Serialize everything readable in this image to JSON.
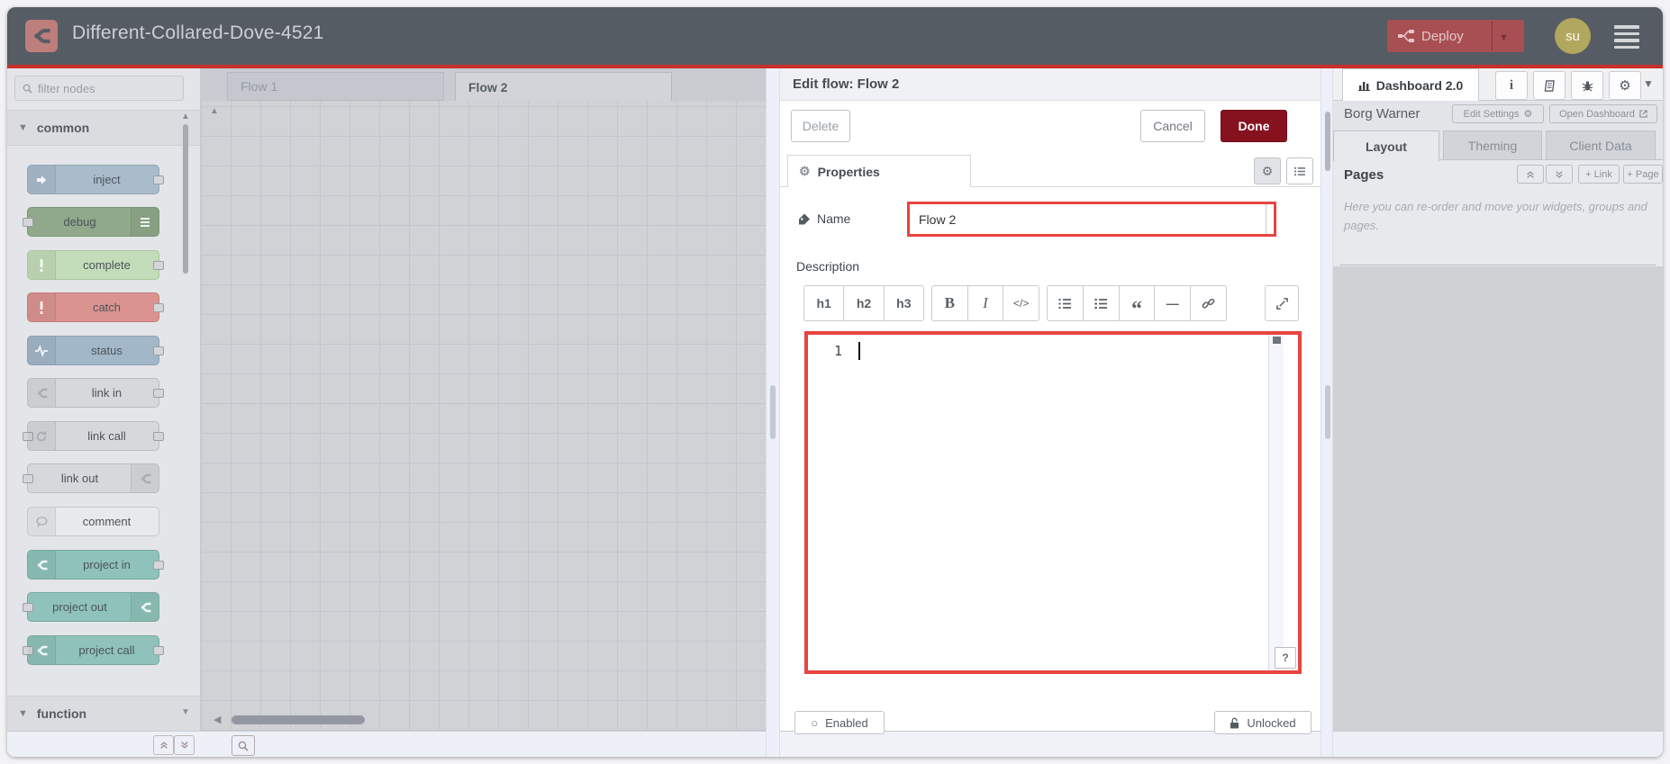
{
  "header": {
    "title": "Different-Collared-Dove-4521",
    "deploy_label": "Deploy",
    "avatar_initials": "su"
  },
  "palette": {
    "search_placeholder": "filter nodes",
    "categories": [
      {
        "label": "common"
      },
      {
        "label": "function"
      }
    ],
    "nodes": [
      {
        "label": "inject",
        "icon": "arrow-right-icon",
        "icon_side": "left",
        "ports": "right",
        "fill": "#a9bccc",
        "border": "#91a7b8",
        "glyph": "#f3f5f7"
      },
      {
        "label": "debug",
        "icon": "list-icon",
        "icon_side": "right",
        "ports": "left",
        "fill": "#8fa98a",
        "border": "#7b9477",
        "glyph": "#eef2ee"
      },
      {
        "label": "complete",
        "icon": "exclamation-icon",
        "icon_side": "left",
        "ports": "right",
        "fill": "#c3dcb9",
        "border": "#a8c79d",
        "glyph": "#f6faf4"
      },
      {
        "label": "catch",
        "icon": "exclamation-icon",
        "icon_side": "left",
        "ports": "right",
        "fill": "#db9390",
        "border": "#c17e7b",
        "glyph": "#f9efee"
      },
      {
        "label": "status",
        "icon": "pulse-icon",
        "icon_side": "left",
        "ports": "right",
        "fill": "#a2b7c7",
        "border": "#8ba3b4",
        "glyph": "#f2f5f8"
      },
      {
        "label": "link in",
        "icon": "fork-icon",
        "icon_side": "left",
        "ports": "right",
        "fill": "#d6d8db",
        "border": "#b9bdc2",
        "glyph": "#a9adb4"
      },
      {
        "label": "link call",
        "icon": "rotate-icon",
        "icon_side": "left",
        "ports": "both",
        "fill": "#d6d8db",
        "border": "#b9bdc2",
        "glyph": "#a9adb4"
      },
      {
        "label": "link out",
        "icon": "fork-icon",
        "icon_side": "right",
        "ports": "left",
        "fill": "#d6d8db",
        "border": "#b9bdc2",
        "glyph": "#a9adb4"
      },
      {
        "label": "comment",
        "icon": "bubble-icon",
        "icon_side": "left",
        "ports": "none",
        "fill": "#e8e9eb",
        "border": "#c5c8cd",
        "glyph": "#a9adb4"
      },
      {
        "label": "project in",
        "icon": "fork-icon",
        "icon_side": "left",
        "ports": "right",
        "fill": "#8fc2ba",
        "border": "#78a9a1",
        "glyph": "#f0f7f6"
      },
      {
        "label": "project out",
        "icon": "fork-icon",
        "icon_side": "right",
        "ports": "left",
        "fill": "#8fc2ba",
        "border": "#78a9a1",
        "glyph": "#f0f7f6"
      },
      {
        "label": "project call",
        "icon": "fork-icon",
        "icon_side": "left",
        "ports": "both",
        "fill": "#8fc2ba",
        "border": "#78a9a1",
        "glyph": "#f0f7f6"
      }
    ]
  },
  "workspace": {
    "tabs": [
      {
        "label": "Flow 1",
        "active": false
      },
      {
        "label": "Flow 2",
        "active": true
      }
    ]
  },
  "dialog": {
    "title": "Edit flow: Flow 2",
    "delete_label": "Delete",
    "cancel_label": "Cancel",
    "done_label": "Done",
    "properties_tab_label": "Properties",
    "name_label": "Name",
    "name_value": "Flow 2",
    "description_label": "Description",
    "toolbar_groups": [
      [
        {
          "id": "h1",
          "label": "h1"
        },
        {
          "id": "h2",
          "label": "h2"
        },
        {
          "id": "h3",
          "label": "h3"
        }
      ],
      [
        {
          "id": "bold",
          "label": "B"
        },
        {
          "id": "italic",
          "label": "I"
        },
        {
          "id": "code",
          "label": "</>"
        }
      ],
      [
        {
          "id": "ordered-list",
          "label": ""
        },
        {
          "id": "unordered-list",
          "label": ""
        },
        {
          "id": "quote",
          "label": "“"
        },
        {
          "id": "hr",
          "label": "—"
        },
        {
          "id": "link",
          "label": ""
        }
      ]
    ],
    "editor": {
      "line_number": "1",
      "help_label": "?"
    },
    "enabled_label": "Enabled",
    "unlocked_label": "Unlocked"
  },
  "sidebar": {
    "dashboard_tab_label": "Dashboard 2.0",
    "owner": "Borg Warner",
    "edit_settings_label": "Edit Settings",
    "open_dashboard_label": "Open Dashboard",
    "tabs": [
      {
        "label": "Layout",
        "active": true
      },
      {
        "label": "Theming",
        "active": false
      },
      {
        "label": "Client Data",
        "active": false
      }
    ],
    "pages_title": "Pages",
    "add_link_label": "+ Link",
    "add_page_label": "+ Page",
    "help_text": "Here you can re-order and move your widgets, groups and pages."
  },
  "colors": {
    "header_bg": "#565c63",
    "header_accent_line": "#c9302c",
    "deploy_bg": "#a84f53",
    "done_bg": "#861220",
    "annotation_red": "#e84440",
    "avatar_bg": "#b2a75f",
    "canvas_bg": "#d0d2d6"
  }
}
